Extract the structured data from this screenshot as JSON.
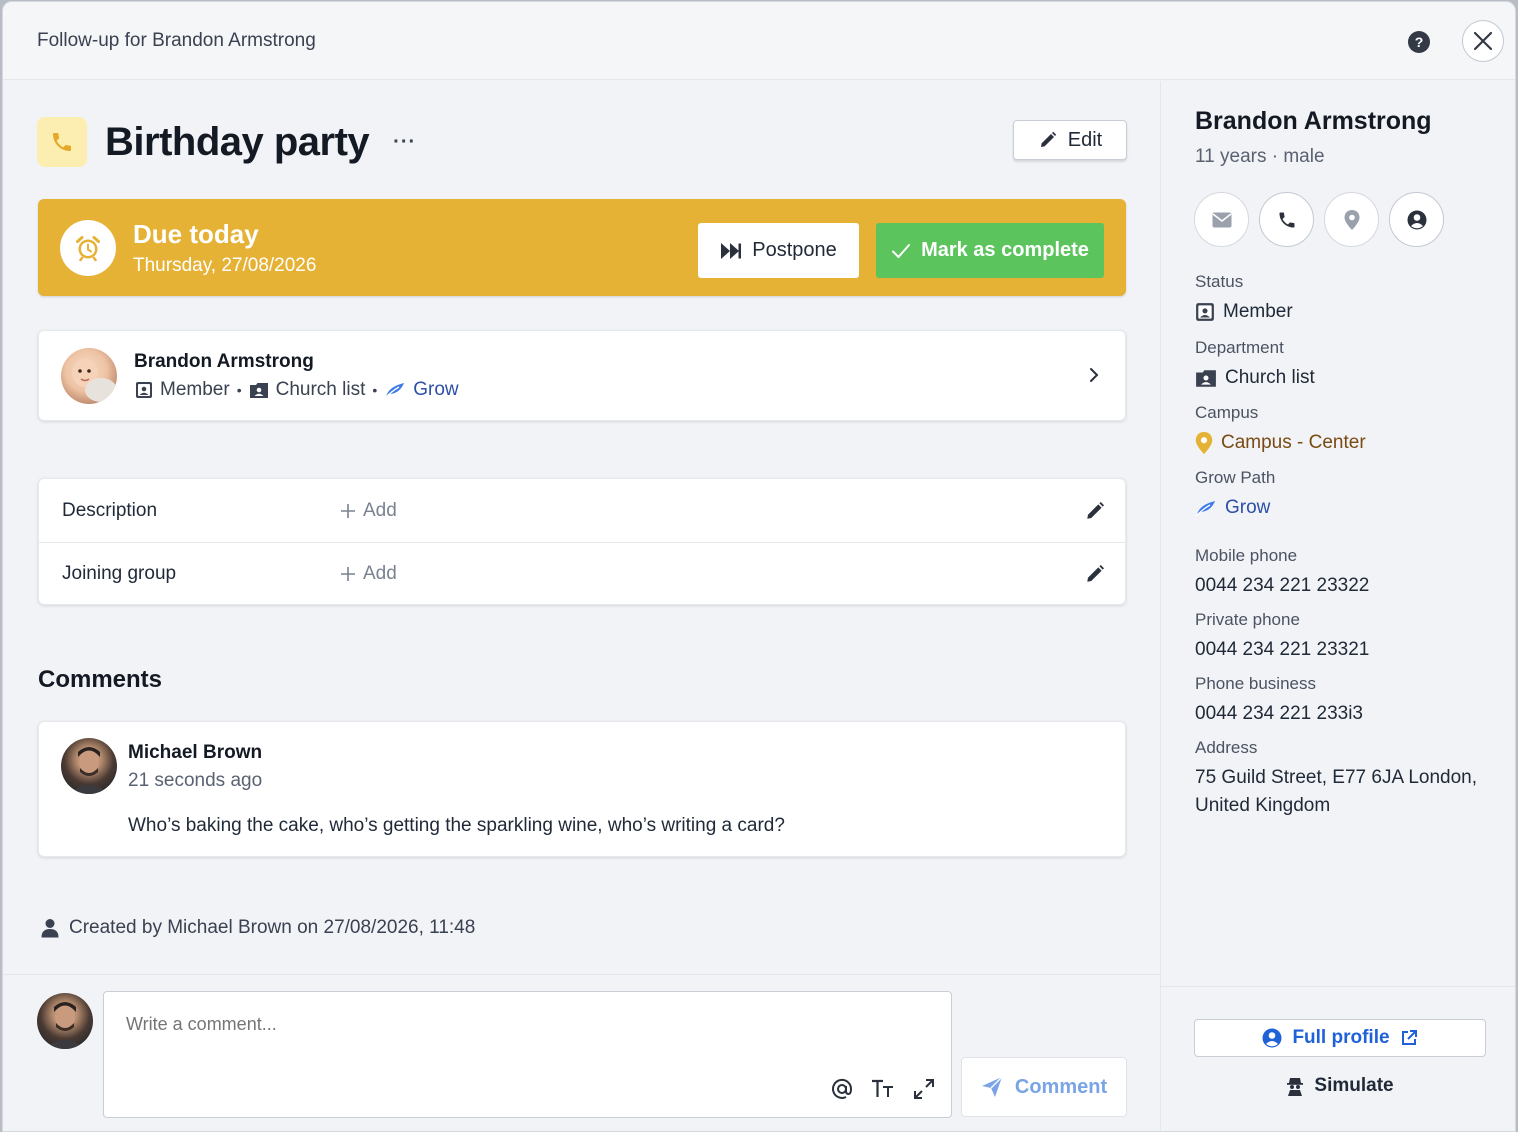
{
  "modal": {
    "title": "Follow-up for Brandon Armstrong",
    "help_label": "?"
  },
  "task": {
    "title": "Birthday party",
    "more_label": "···",
    "edit_label": "Edit",
    "icon": "phone-icon",
    "icon_bg": "#fbeeb0",
    "icon_color": "#e5b236"
  },
  "due": {
    "title": "Due today",
    "date": "Thursday, 27/08/2026",
    "postpone_label": "Postpone",
    "complete_label": "Mark as complete",
    "banner_color": "#e5b236",
    "complete_color": "#5cc45d"
  },
  "person": {
    "name": "Brandon Armstrong",
    "status": "Member",
    "department": "Church list",
    "grow": "Grow"
  },
  "fields": [
    {
      "label": "Description",
      "add_label": "Add"
    },
    {
      "label": "Joining group",
      "add_label": "Add"
    }
  ],
  "comments": {
    "title": "Comments",
    "items": [
      {
        "author": "Michael Brown",
        "time": "21 seconds ago",
        "text": "Who’s baking the cake, who’s getting the sparkling wine, who’s writing a card?"
      }
    ]
  },
  "created_by": "Created by Michael Brown on 27/08/2026, 11:48",
  "composer": {
    "placeholder": "Write a comment...",
    "submit_label": "Comment"
  },
  "sidebar": {
    "name": "Brandon Armstrong",
    "age_gender": "11 years · male",
    "contact_icons": [
      "mail-icon",
      "phone-icon",
      "location-icon",
      "user-circle-icon"
    ],
    "info": [
      {
        "label": "Status",
        "value": "Member",
        "icon": "member-card-icon"
      },
      {
        "label": "Department",
        "value": "Church list",
        "icon": "department-icon"
      },
      {
        "label": "Campus",
        "value": "Campus - Center",
        "icon": "location-pin-icon"
      },
      {
        "label": "Grow Path",
        "value": "Grow",
        "icon": "grow-leaf-icon"
      },
      {
        "label": "Mobile phone",
        "value": "0044 234 221 23322"
      },
      {
        "label": "Private phone",
        "value": "0044 234 221 23321"
      },
      {
        "label": "Phone business",
        "value": "0044 234 221 233i3"
      },
      {
        "label": "Address",
        "value": "75 Guild Street, E77 6JA London, United Kingdom"
      }
    ],
    "full_profile_label": "Full profile",
    "simulate_label": "Simulate",
    "accent": "#1f62d8"
  }
}
